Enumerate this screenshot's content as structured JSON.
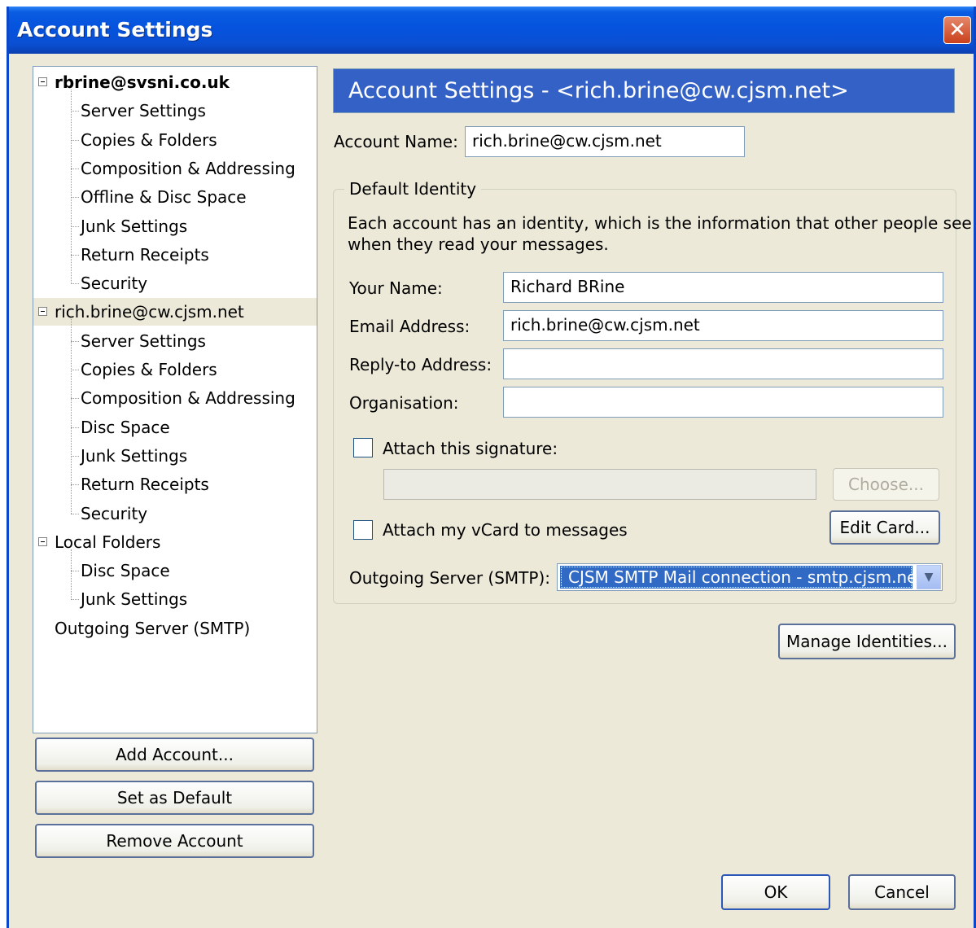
{
  "window": {
    "title": "Account Settings"
  },
  "tree": {
    "accounts": [
      {
        "name": "rbrine@svsni.co.uk",
        "items": [
          "Server Settings",
          "Copies & Folders",
          "Composition & Addressing",
          "Offline & Disc Space",
          "Junk Settings",
          "Return Receipts",
          "Security"
        ]
      },
      {
        "name": "rich.brine@cw.cjsm.net",
        "items": [
          "Server Settings",
          "Copies & Folders",
          "Composition & Addressing",
          "Disc Space",
          "Junk Settings",
          "Return Receipts",
          "Security"
        ]
      },
      {
        "name": "Local Folders",
        "items": [
          "Disc Space",
          "Junk Settings"
        ]
      }
    ],
    "outgoing": "Outgoing Server (SMTP)"
  },
  "left_buttons": {
    "add_account": "Add Account...",
    "set_default": "Set as Default",
    "remove_account": "Remove Account"
  },
  "panel": {
    "header": "Account Settings - <rich.brine@cw.cjsm.net>",
    "account_name_label": "Account Name:",
    "account_name_value": "rich.brine@cw.cjsm.net",
    "group_title": "Default Identity",
    "description_line1": "Each account has an identity, which is the information that other people see",
    "description_line2": "when they read your messages.",
    "your_name_label": "Your Name:",
    "your_name_value": "Richard BRine",
    "email_label": "Email Address:",
    "email_value": "rich.brine@cw.cjsm.net",
    "reply_to_label": "Reply-to Address:",
    "reply_to_value": "",
    "organisation_label": "Organisation:",
    "organisation_value": "",
    "attach_signature_label": "Attach this signature:",
    "attach_signature_checked": false,
    "signature_path": "",
    "choose_button": "Choose...",
    "attach_vcard_label": "Attach my vCard to messages",
    "attach_vcard_checked": false,
    "edit_card_button": "Edit Card...",
    "outgoing_label": "Outgoing Server (SMTP):",
    "outgoing_value": "CJSM SMTP  Mail connection - smtp.cjsm.net",
    "manage_identities_button": "Manage Identities..."
  },
  "footer": {
    "ok": "OK",
    "cancel": "Cancel"
  }
}
